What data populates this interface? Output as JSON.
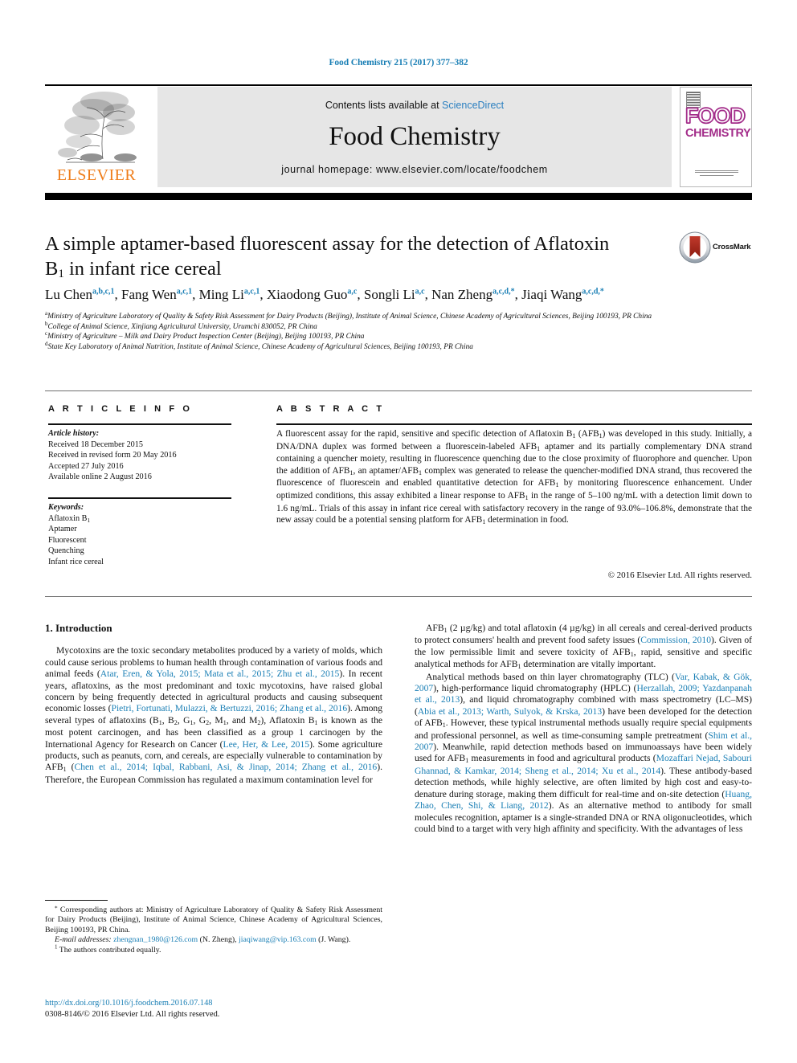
{
  "running_head": "Food Chemistry 215 (2017) 377–382",
  "header": {
    "publisher": "ELSEVIER",
    "contents_prefix": "Contents lists available at ",
    "contents_link": "ScienceDirect",
    "journal_title": "Food Chemistry",
    "homepage": "journal homepage: www.elsevier.com/locate/foodchem",
    "cover": {
      "line1": "FOOD",
      "line2": "CHEMISTRY"
    },
    "accent_link": "#2a7fc0",
    "elsevier_orange": "#ef7d1a",
    "cover_magenta": "#a32d8a"
  },
  "article": {
    "title_line1": "A simple aptamer-based fluorescent assay for the detection of Aflatoxin",
    "title_line2_pre": "B",
    "title_line2_sub": "1",
    "title_line2_post": " in infant rice cereal",
    "crossmark_label": "CrossMark",
    "authors": [
      {
        "name": "Lu Chen",
        "sup": "a,b,c,1"
      },
      {
        "name": "Fang Wen",
        "sup": "a,c,1"
      },
      {
        "name": "Ming Li",
        "sup": "a,c,1"
      },
      {
        "name": "Xiaodong Guo",
        "sup": "a,c"
      },
      {
        "name": "Songli Li",
        "sup": "a,c"
      },
      {
        "name": "Nan Zheng",
        "sup": "a,c,d,*"
      },
      {
        "name": "Jiaqi Wang",
        "sup": "a,c,d,*"
      }
    ],
    "affiliations": [
      {
        "mark": "a",
        "text": "Ministry of Agriculture Laboratory of Quality & Safety Risk Assessment for Dairy Products (Beijing), Institute of Animal Science, Chinese Academy of Agricultural Sciences, Beijing 100193, PR China"
      },
      {
        "mark": "b",
        "text": "College of Animal Science, Xinjiang Agricultural University, Urumchi 830052, PR China"
      },
      {
        "mark": "c",
        "text": "Ministry of Agriculture – Milk and Dairy Product Inspection Center (Beijing), Beijing 100193, PR China"
      },
      {
        "mark": "d",
        "text": "State Key Laboratory of Animal Nutrition, Institute of Animal Science, Chinese Academy of Agricultural Sciences, Beijing 100193, PR China"
      }
    ]
  },
  "article_info": {
    "section_label": "A R T I C L E   I N F O",
    "history_header": "Article history:",
    "history": [
      "Received 18 December 2015",
      "Received in revised form 20 May 2016",
      "Accepted 27 July 2016",
      "Available online 2 August 2016"
    ],
    "keywords_header": "Keywords:",
    "keywords": [
      "Aflatoxin B1",
      "Aptamer",
      "Fluorescent",
      "Quenching",
      "Infant rice cereal"
    ]
  },
  "abstract": {
    "section_label": "A B S T R A C T",
    "body": "A fluorescent assay for the rapid, sensitive and specific detection of Aflatoxin B1 (AFB1) was developed in this study. Initially, a DNA/DNA duplex was formed between a fluorescein-labeled AFB1 aptamer and its partially complementary DNA strand containing a quencher moiety, resulting in fluorescence quenching due to the close proximity of fluorophore and quencher. Upon the addition of AFB1, an aptamer/AFB1 complex was generated to release the quencher-modified DNA strand, thus recovered the fluorescence of fluorescein and enabled quantitative detection for AFB1 by monitoring fluorescence enhancement. Under optimized conditions, this assay exhibited a linear response to AFB1 in the range of 5–100 ng/mL with a detection limit down to 1.6 ng/mL. Trials of this assay in infant rice cereal with satisfactory recovery in the range of 93.0%–106.8%, demonstrate that the new assay could be a potential sensing platform for AFB1 determination in food.",
    "copyright": "© 2016 Elsevier Ltd. All rights reserved."
  },
  "introduction": {
    "heading": "1. Introduction",
    "left_paragraph": "Mycotoxins are the toxic secondary metabolites produced by a variety of molds, which could cause serious problems to human health through contamination of various foods and animal feeds (Atar, Eren, & Yola, 2015; Mata et al., 2015; Zhu et al., 2015). In recent years, aflatoxins, as the most predominant and toxic mycotoxins, have raised global concern by being frequently detected in agricultural products and causing subsequent economic losses (Pietri, Fortunati, Mulazzi, & Bertuzzi, 2016; Zhang et al., 2016). Among several types of aflatoxins (B1, B2, G1, G2, M1, and M2), Aflatoxin B1 is known as the most potent carcinogen, and has been classified as a group 1 carcinogen by the International Agency for Research on Cancer (Lee, Her, & Lee, 2015). Some agriculture products, such as peanuts, corn, and cereals, are especially vulnerable to contamination by AFB1 (Chen et al., 2014; Iqbal, Rabbani, Asi, & Jinap, 2014; Zhang et al., 2016). Therefore, the European Commission has regulated a maximum contamination level for",
    "right_paragraph_1": "AFB1 (2 µg/kg) and total aflatoxin (4 µg/kg) in all cereals and cereal-derived products to protect consumers' health and prevent food safety issues (Commission, 2010). Given of the low permissible limit and severe toxicity of AFB1, rapid, sensitive and specific analytical methods for AFB1 determination are vitally important.",
    "right_paragraph_2": "Analytical methods based on thin layer chromatography (TLC) (Var, Kabak, & Gök, 2007), high-performance liquid chromatography (HPLC) (Herzallah, 2009; Yazdanpanah et al., 2013), and liquid chromatography combined with mass spectrometry (LC–MS) (Abia et al., 2013; Warth, Sulyok, & Krska, 2013) have been developed for the detection of AFB1. However, these typical instrumental methods usually require special equipments and professional personnel, as well as time-consuming sample pretreatment (Shim et al., 2007). Meanwhile, rapid detection methods based on immunoassays have been widely used for AFB1 measurements in food and agricultural products (Mozaffari Nejad, Sabouri Ghannad, & Kamkar, 2014; Sheng et al., 2014; Xu et al., 2014). These antibody-based detection methods, while highly selective, are often limited by high cost and easy-to-denature during storage, making them difficult for real-time and on-site detection (Huang, Zhao, Chen, Shi, & Liang, 2012). As an alternative method to antibody for small molecules recognition, aptamer is a single-stranded DNA or RNA oligonucleotides, which could bind to a target with very high affinity and specificity. With the advantages of less"
  },
  "footnotes": {
    "corresponding_mark": "⁎",
    "corresponding": "Corresponding authors at: Ministry of Agriculture Laboratory of Quality & Safety Risk Assessment for Dairy Products (Beijing), Institute of Animal Science, Chinese Academy of Agricultural Sciences, Beijing 100193, PR China.",
    "email_label": "E-mail addresses:",
    "email_1": "zhengnan_1980@126.com",
    "email_1_owner": "(N. Zheng),",
    "email_2": "jiaqiwang@vip.163.com",
    "email_2_owner": "(J. Wang).",
    "equal_mark": "1",
    "equal_contrib": "The authors contributed equally."
  },
  "doi": {
    "url": "http://dx.doi.org/10.1016/j.foodchem.2016.07.148",
    "issn_line": "0308-8146/© 2016 Elsevier Ltd. All rights reserved."
  }
}
